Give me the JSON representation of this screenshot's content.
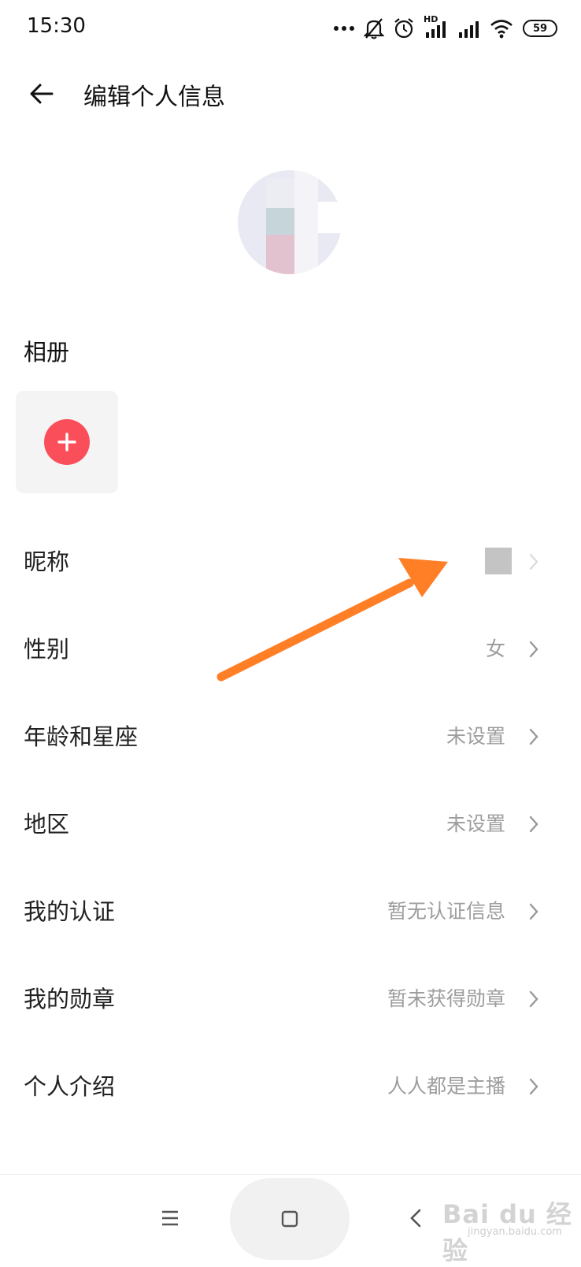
{
  "status_bar": {
    "time": "15:30",
    "net_label": "HD",
    "battery": "59",
    "icons": [
      "more-dots-icon",
      "mute-icon",
      "alarm-icon",
      "signal-hd-icon",
      "signal-icon",
      "wifi-icon",
      "battery-icon"
    ]
  },
  "header": {
    "title": "编辑个人信息",
    "back_icon": "back-arrow-icon"
  },
  "album": {
    "label": "相册",
    "add_icon": "plus-icon",
    "accent": "#fa4f5a"
  },
  "rows": [
    {
      "label": "昵称",
      "value": ""
    },
    {
      "label": "性别",
      "value": "女"
    },
    {
      "label": "年龄和星座",
      "value": "未设置"
    },
    {
      "label": "地区",
      "value": "未设置"
    },
    {
      "label": "我的认证",
      "value": "暂无认证信息"
    },
    {
      "label": "我的勋章",
      "value": "暂未获得勋章"
    },
    {
      "label": "个人介绍",
      "value": "人人都是主播"
    }
  ],
  "annotation": {
    "color": "#ff7f27"
  },
  "nav": {
    "icons": [
      "menu-icon",
      "home-icon",
      "back-icon"
    ]
  },
  "watermark": {
    "text": "Bai du 经验",
    "sub": "jingyan.baidu.com"
  }
}
